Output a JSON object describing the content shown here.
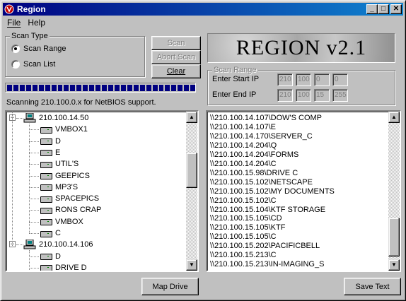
{
  "window": {
    "title": "Region"
  },
  "titlebar_buttons": {
    "minimize": "_",
    "maximize": "□",
    "close": "✕"
  },
  "menu": [
    "File",
    "Help"
  ],
  "scan_type": {
    "label": "Scan Type",
    "options": [
      {
        "label": "Scan Range",
        "selected": true
      },
      {
        "label": "Scan List",
        "selected": false
      }
    ]
  },
  "buttons": {
    "scan": "Scan",
    "abort_scan": "Abort Scan",
    "clear": "Clear",
    "map_drive": "Map Drive",
    "save_text": "Save Text"
  },
  "banner": "REGION v2.1",
  "scan_range": {
    "label": "Scan Range",
    "start_label": "Enter Start IP",
    "end_label": "Enter End IP",
    "start_ip": [
      "210",
      "100",
      "0",
      "0"
    ],
    "end_ip": [
      "210",
      "100",
      "15",
      "255"
    ]
  },
  "progress": {
    "blocks": 30
  },
  "status_text": "Scanning 210.100.0.x for NetBIOS support.",
  "tree": [
    {
      "type": "host",
      "label": "210.100.14.50"
    },
    {
      "type": "share",
      "label": "VMBOX1"
    },
    {
      "type": "share",
      "label": "D"
    },
    {
      "type": "share",
      "label": "E"
    },
    {
      "type": "share",
      "label": "UTIL'S"
    },
    {
      "type": "share",
      "label": "GEEPICS"
    },
    {
      "type": "share",
      "label": "MP3'S"
    },
    {
      "type": "share",
      "label": "SPACEPICS"
    },
    {
      "type": "share",
      "label": "RONS CRAP"
    },
    {
      "type": "share",
      "label": "VMBOX"
    },
    {
      "type": "share",
      "label": "C"
    },
    {
      "type": "host",
      "label": "210.100.14.106"
    },
    {
      "type": "share",
      "label": "D"
    },
    {
      "type": "share",
      "label": "DRIVE D"
    }
  ],
  "results": [
    "\\\\210.100.14.107\\DOW'S COMP",
    "\\\\210.100.14.107\\E",
    "\\\\210.100.14.170\\SERVER_C",
    "\\\\210.100.14.204\\Q",
    "\\\\210.100.14.204\\FORMS",
    "\\\\210.100.14.204\\C",
    "\\\\210.100.15.98\\DRIVE C",
    "\\\\210.100.15.102\\NETSCAPE",
    "\\\\210.100.15.102\\MY DOCUMENTS",
    "\\\\210.100.15.102\\C",
    "\\\\210.100.15.104\\KTF STORAGE",
    "\\\\210.100.15.105\\CD",
    "\\\\210.100.15.105\\KTF",
    "\\\\210.100.15.105\\C",
    "\\\\210.100.15.202\\PACIFICBELL",
    "\\\\210.100.15.213\\C",
    "\\\\210.100.15.213\\IN-IMAGING_S"
  ],
  "colors": {
    "titlebar": "#000080",
    "face": "#c0c0c0",
    "progress": "#000080"
  }
}
